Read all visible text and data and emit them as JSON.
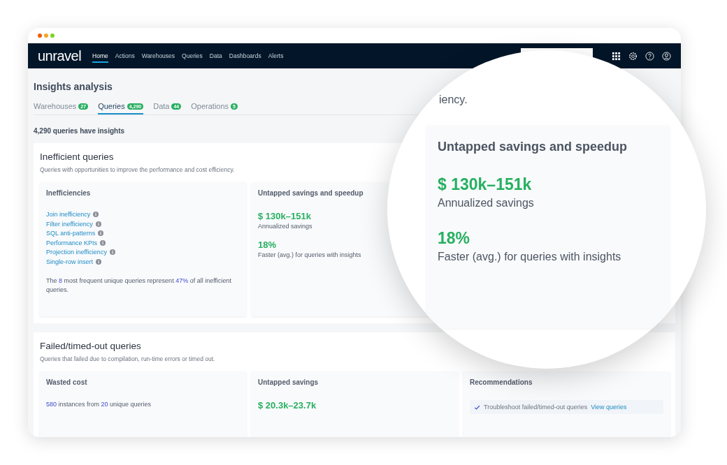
{
  "browser": {
    "dots": [
      {
        "color": "#f25c05"
      },
      {
        "color": "#f5a623"
      },
      {
        "color": "#7ed321"
      }
    ]
  },
  "navbar": {
    "logo": "unravel",
    "items": [
      {
        "label": "Home",
        "selected": true
      },
      {
        "label": "Actions",
        "selected": false
      },
      {
        "label": "Warehouses",
        "selected": false
      },
      {
        "label": "Queries",
        "selected": false
      },
      {
        "label": "Data",
        "selected": false
      },
      {
        "label": "Dashboards",
        "selected": false
      },
      {
        "label": "Alerts",
        "selected": false
      }
    ]
  },
  "page": {
    "title": "Insights analysis",
    "tabs": [
      {
        "label": "Warehouses",
        "count": "27",
        "selected": false
      },
      {
        "label": "Queries",
        "count": "4,290",
        "selected": true
      },
      {
        "label": "Data",
        "count": "44",
        "selected": false
      },
      {
        "label": "Operations",
        "count": "5",
        "selected": false
      }
    ],
    "summary": "4,290 queries have insights"
  },
  "sections": [
    {
      "title": "Inefficient queries",
      "description": "Queries with opportunities to improve the performance and cost efficiency.",
      "cards": [
        {
          "kind": "links",
          "title": "Inefficiencies",
          "links": [
            "Join inefficiency",
            "Filter inefficiency",
            "SQL anti-patterns",
            "Performance KPIs",
            "Projection inefficiency",
            "Single-row insert"
          ],
          "note": "The **8** most frequent unique queries represent **47%** of all inefficient queries."
        },
        {
          "kind": "metrics",
          "title": "Untapped savings and speedup",
          "metrics": [
            {
              "value": "$ 130k–151k",
              "label": "Annualized savings"
            },
            {
              "value": "18%",
              "label": "Faster (avg.) for queries with insights"
            }
          ]
        }
      ]
    },
    {
      "title": "Failed/timed-out queries",
      "description": "Queries that failed due to compilation, run-time errors or timed out.",
      "cards": [
        {
          "kind": "text",
          "title": "Wasted cost",
          "note": "**580** instances from **20** unique queries"
        },
        {
          "kind": "metrics",
          "title": "Untapped savings",
          "metrics": [
            {
              "value": "$ 20.3k–23.7k"
            }
          ]
        },
        {
          "kind": "recommendations",
          "title": "Recommendations",
          "items": [
            {
              "text": "Troubleshoot failed/timed-out queries",
              "link": "View queries",
              "checked": true
            }
          ]
        }
      ]
    }
  ],
  "magnifier": {
    "fragment": "iency.",
    "card": {
      "title": "Untapped savings and speedup",
      "metrics": [
        {
          "value": "$ 130k–151k",
          "label": "Annualized savings"
        },
        {
          "value": "18%",
          "label": "Faster (avg.) for queries with insights"
        }
      ]
    }
  }
}
